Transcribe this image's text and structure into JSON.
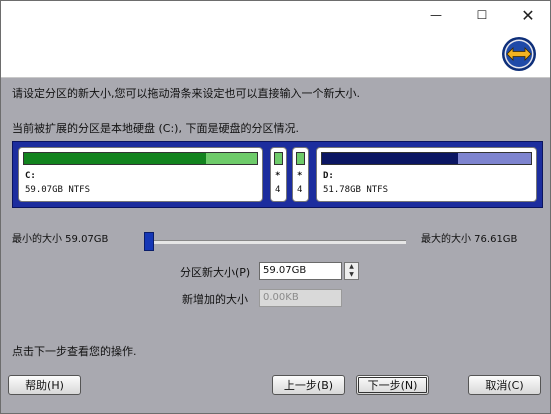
{
  "window": {
    "min_glyph": "—",
    "max_glyph": "☐",
    "close_glyph": "✕"
  },
  "logo": {
    "icon": "disk-resize-arrows"
  },
  "instructions": {
    "line1": "请设定分区的新大小,您可以拖动滑条来设定也可以直接输入一个新大小.",
    "line2": "当前被扩展的分区是本地硬盘 (C:), 下面是硬盘的分区情况."
  },
  "disk_map": {
    "partitions": [
      {
        "name": "C:",
        "info": "59.07GB NTFS",
        "used_fraction": 0.78,
        "used_color": "#12831e",
        "free_color": "#6ecb6a"
      },
      {
        "name": "*",
        "info": "4",
        "used_fraction": 0.0,
        "used_color": "#12831e",
        "free_color": "#6ecb6a"
      },
      {
        "name": "*",
        "info": "4",
        "used_fraction": 0.0,
        "used_color": "#12831e",
        "free_color": "#6ecb6a"
      },
      {
        "name": "D:",
        "info": "51.78GB NTFS",
        "used_fraction": 0.65,
        "used_color": "#0b1663",
        "free_color": "#7e84cf"
      }
    ]
  },
  "slider": {
    "min_label": "最小的大小 59.07GB",
    "max_label": "最大的大小 76.61GB",
    "position_fraction": 0.0
  },
  "size": {
    "new_label": "分区新大小(P)",
    "new_value": "59.07GB",
    "increase_label": "新增加的大小",
    "increase_value": "0.00KB"
  },
  "footer_hint": "点击下一步查看您的操作.",
  "buttons": {
    "help": "帮助(H)",
    "back": "上一步(B)",
    "next": "下一步(N)",
    "cancel": "取消(C)"
  }
}
